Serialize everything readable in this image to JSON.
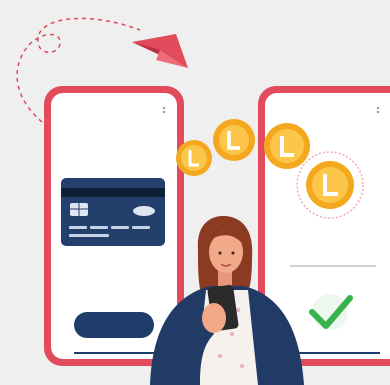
{
  "colors": {
    "background": "#efefef",
    "phone_frame": "#e24b5c",
    "card": "#233f6b",
    "card_stripe": "#0e1e36",
    "button": "#1f3c6b",
    "coin": "#f4a81d",
    "coin_light": "#fbc64a",
    "check": "#38b24a",
    "plane": "#e24b5c",
    "hair": "#8a3b21",
    "skin": "#f2a98a",
    "jacket": "#213a66",
    "phone_held": "#2a2a2a"
  },
  "icons": {
    "plane": "paper-plane-icon",
    "coin": "coin-icon",
    "card": "credit-card-icon",
    "check": "checkmark-icon"
  }
}
